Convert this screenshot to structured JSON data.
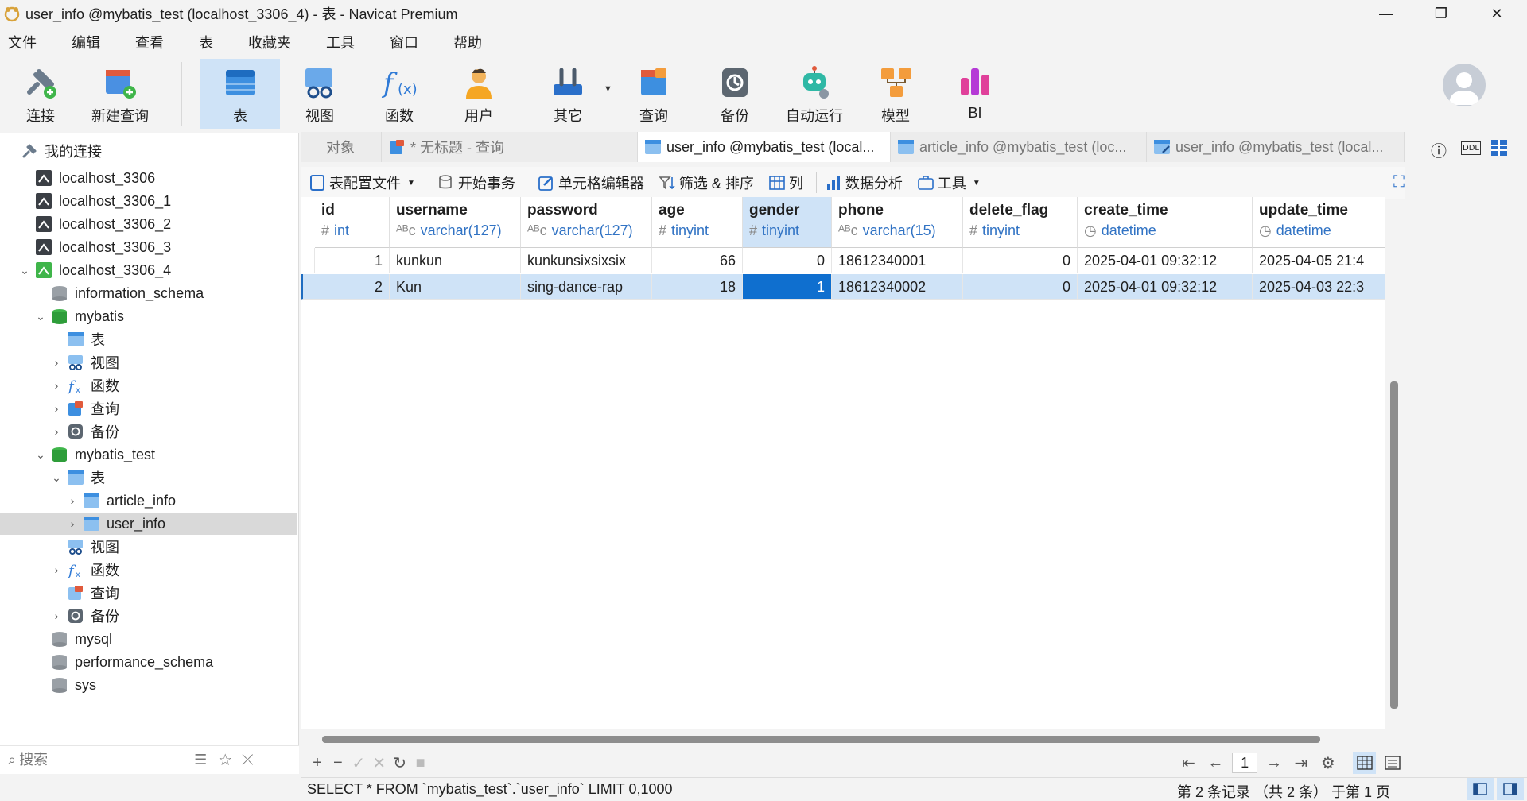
{
  "window": {
    "title": "user_info @mybatis_test (localhost_3306_4) - 表 - Navicat Premium",
    "controls": [
      "—",
      "❐",
      "✕"
    ]
  },
  "menu": [
    "文件",
    "编辑",
    "查看",
    "表",
    "收藏夹",
    "工具",
    "窗口",
    "帮助"
  ],
  "toolbar": {
    "buttons": [
      {
        "label": "连接",
        "icon": "plug-icon"
      },
      {
        "label": "新建查询",
        "icon": "new-query-icon"
      },
      {
        "label": "表",
        "icon": "table-icon"
      },
      {
        "label": "视图",
        "icon": "view-icon"
      },
      {
        "label": "函数",
        "icon": "function-icon"
      },
      {
        "label": "用户",
        "icon": "user-icon"
      },
      {
        "label": "其它",
        "icon": "tools-icon"
      },
      {
        "label": "查询",
        "icon": "query-icon"
      },
      {
        "label": "备份",
        "icon": "backup-icon"
      },
      {
        "label": "自动运行",
        "icon": "robot-icon"
      },
      {
        "label": "模型",
        "icon": "model-icon"
      },
      {
        "label": "BI",
        "icon": "bi-icon"
      }
    ]
  },
  "sidebar": {
    "header": "我的连接",
    "items": [
      {
        "label": "localhost_3306"
      },
      {
        "label": "localhost_3306_1"
      },
      {
        "label": "localhost_3306_2"
      },
      {
        "label": "localhost_3306_3"
      },
      {
        "label": "localhost_3306_4"
      },
      {
        "label": "information_schema"
      },
      {
        "label": "mybatis"
      },
      {
        "label": "表"
      },
      {
        "label": "视图"
      },
      {
        "label": "函数"
      },
      {
        "label": "查询"
      },
      {
        "label": "备份"
      },
      {
        "label": "mybatis_test"
      },
      {
        "label": "表"
      },
      {
        "label": "article_info"
      },
      {
        "label": "user_info"
      },
      {
        "label": "视图"
      },
      {
        "label": "函数"
      },
      {
        "label": "查询"
      },
      {
        "label": "备份"
      },
      {
        "label": "mysql"
      },
      {
        "label": "performance_schema"
      },
      {
        "label": "sys"
      }
    ],
    "search_placeholder": "搜索"
  },
  "tabs": [
    {
      "label": "对象"
    },
    {
      "label": "* 无标题 - 查询"
    },
    {
      "label": "user_info @mybatis_test (local..."
    },
    {
      "label": "article_info @mybatis_test (loc..."
    },
    {
      "label": "user_info @mybatis_test (local..."
    }
  ],
  "subtoolbar": {
    "profile": "表配置文件",
    "begin_tx": "开始事务",
    "cell_editor": "单元格编辑器",
    "filter_sort": "筛选 & 排序",
    "columns": "列",
    "analysis": "数据分析",
    "tools": "工具"
  },
  "grid": {
    "columns": [
      {
        "name": "id",
        "type": "int",
        "sym": "#"
      },
      {
        "name": "username",
        "type": "varchar(127)",
        "sym": "ᴬᴮc"
      },
      {
        "name": "password",
        "type": "varchar(127)",
        "sym": "ᴬᴮc"
      },
      {
        "name": "age",
        "type": "tinyint",
        "sym": "#"
      },
      {
        "name": "gender",
        "type": "tinyint",
        "sym": "#"
      },
      {
        "name": "phone",
        "type": "varchar(15)",
        "sym": "ᴬᴮc"
      },
      {
        "name": "delete_flag",
        "type": "tinyint",
        "sym": "#"
      },
      {
        "name": "create_time",
        "type": "datetime",
        "sym": "◷"
      },
      {
        "name": "update_time",
        "type": "datetime",
        "sym": "◷"
      }
    ],
    "rows": [
      [
        "1",
        "kunkun",
        "kunkunsixsixsix",
        "66",
        "0",
        "18612340001",
        "0",
        "2025-04-01 09:32:12",
        "2025-04-05 21:4"
      ],
      [
        "2",
        "Kun",
        "sing-dance-rap",
        "18",
        "1",
        "18612340002",
        "0",
        "2025-04-01 09:32:12",
        "2025-04-03 22:3"
      ]
    ]
  },
  "footer": {
    "page": "1"
  },
  "status": {
    "sql": "SELECT * FROM `mybatis_test`.`user_info` LIMIT 0,1000",
    "record": "第 2 条记录 （共 2 条） 于第 1 页"
  }
}
